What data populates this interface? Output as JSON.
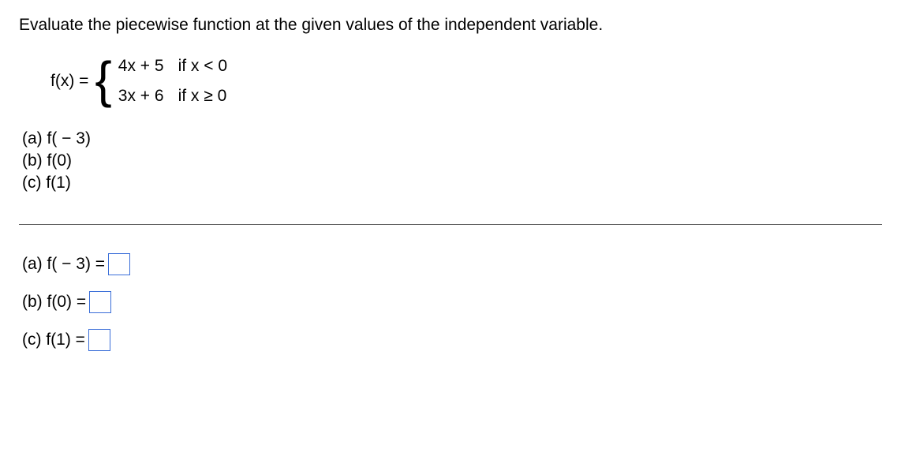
{
  "instruction": "Evaluate the piecewise function at the given values of the independent variable.",
  "function": {
    "lhs": "f(x) =",
    "pieces": [
      {
        "expr": "4x + 5",
        "cond": "if x < 0"
      },
      {
        "expr": "3x + 6",
        "cond": "if x ≥ 0"
      }
    ]
  },
  "question_items": [
    "(a) f( − 3)",
    "(b) f(0)",
    "(c) f(1)"
  ],
  "answers": [
    {
      "label": "(a) f( − 3) =",
      "value": ""
    },
    {
      "label": "(b) f(0) =",
      "value": ""
    },
    {
      "label": "(c) f(1) =",
      "value": ""
    }
  ]
}
